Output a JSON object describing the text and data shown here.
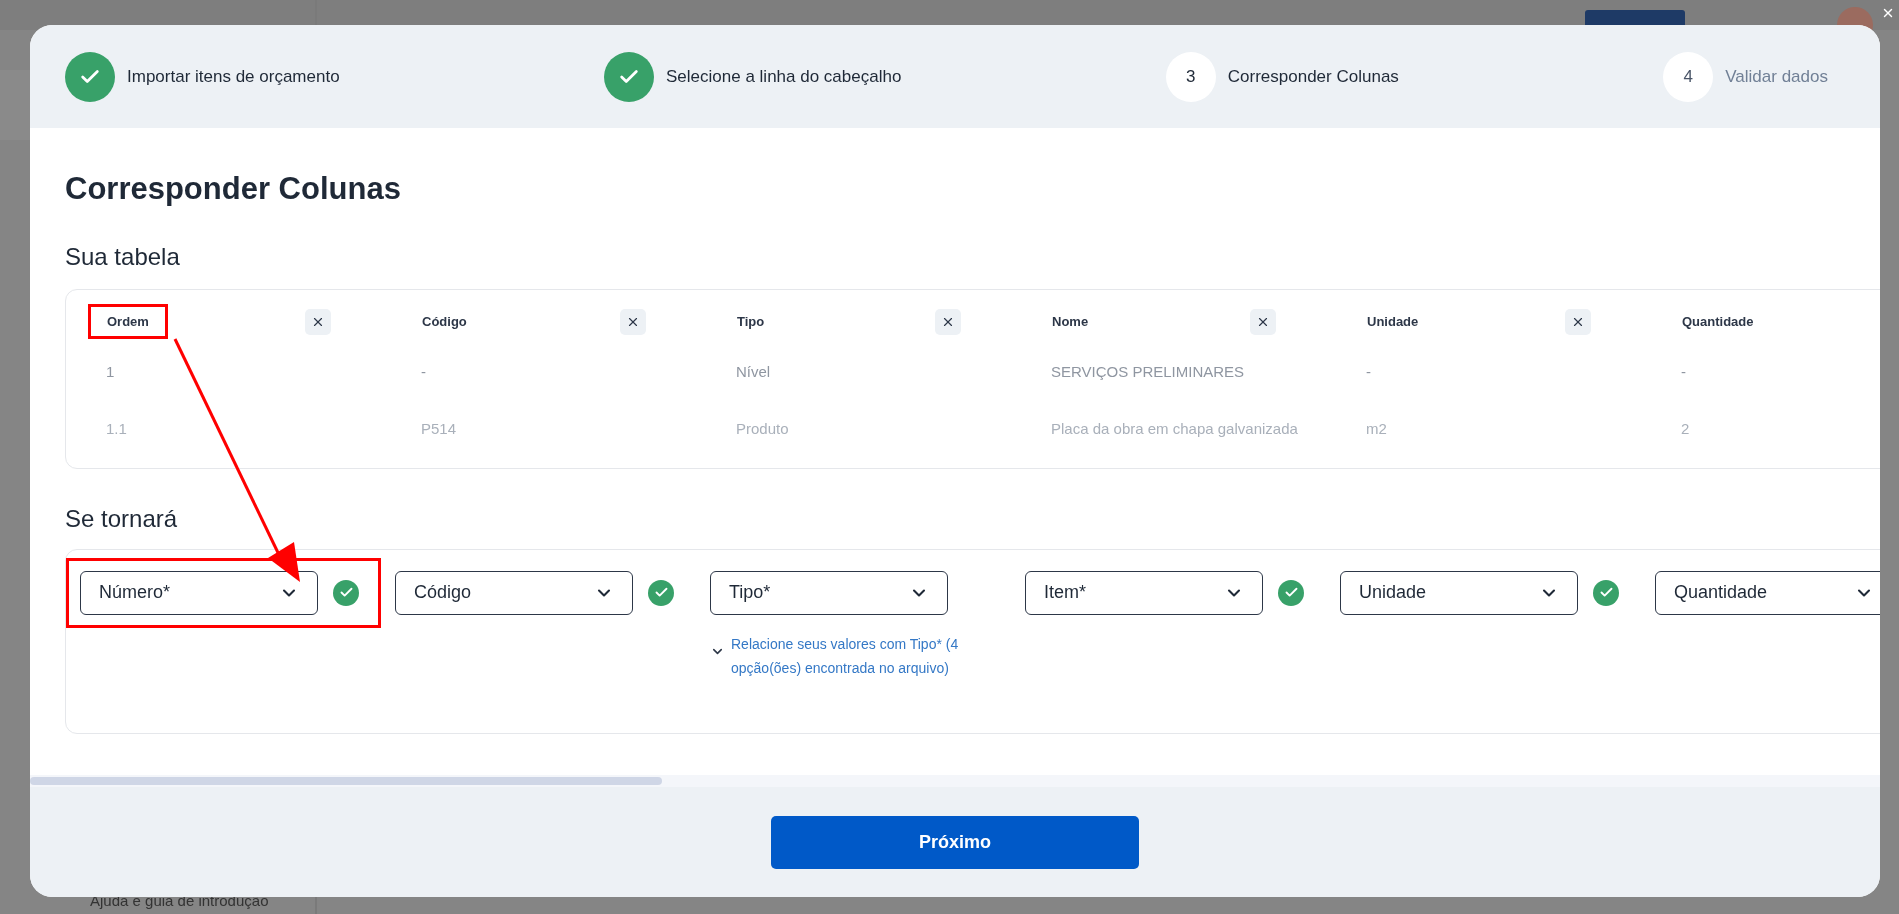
{
  "background": {
    "help_link": "Ajuda e guia de introdução"
  },
  "steps": [
    {
      "kind": "done",
      "label": "Importar itens de orçamento"
    },
    {
      "kind": "done",
      "label": "Selecione a linha do cabeçalho"
    },
    {
      "kind": "current",
      "number": "3",
      "label": "Corresponder Colunas"
    },
    {
      "kind": "pending",
      "number": "4",
      "label": "Validar dados"
    }
  ],
  "title": "Corresponder Colunas",
  "source_heading": "Sua tabela",
  "columns": [
    {
      "name": "Ordem",
      "highlighted": true
    },
    {
      "name": "Código",
      "highlighted": false
    },
    {
      "name": "Tipo",
      "highlighted": false
    },
    {
      "name": "Nome",
      "highlighted": false
    },
    {
      "name": "Unidade",
      "highlighted": false
    },
    {
      "name": "Quantidade",
      "highlighted": false
    }
  ],
  "rows": [
    [
      "1",
      "-",
      "Nível",
      "SERVIÇOS PRELIMINARES",
      "-",
      "-"
    ],
    [
      "1.1",
      "P514",
      "Produto",
      "Placa da obra em chapa galvanizada",
      "m2",
      "2"
    ]
  ],
  "target_heading": "Se tornará",
  "mappings": [
    {
      "value": "Número*",
      "matched": true,
      "highlighted": true
    },
    {
      "value": "Código",
      "matched": true,
      "highlighted": false
    },
    {
      "value": "Tipo*",
      "matched": false,
      "highlighted": false,
      "hint": "Relacione seus valores com Tipo* (4 opção(ões) encontrada no arquivo)"
    },
    {
      "value": "Item*",
      "matched": true,
      "highlighted": false
    },
    {
      "value": "Unidade",
      "matched": true,
      "highlighted": false
    },
    {
      "value": "Quantidade",
      "matched": false,
      "highlighted": false
    }
  ],
  "next_button": "Próximo"
}
